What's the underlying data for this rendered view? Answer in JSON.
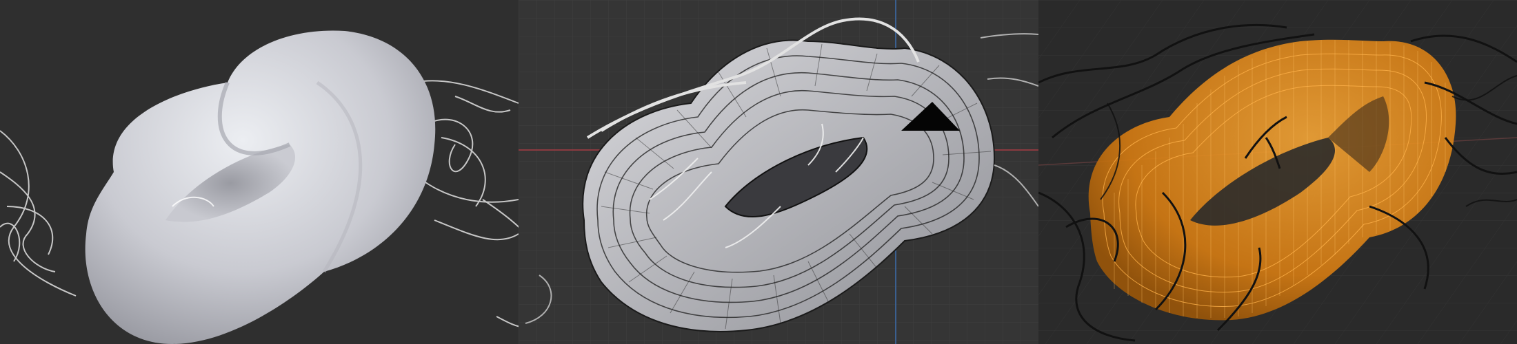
{
  "image": {
    "panels": [
      {
        "name": "solid-shaded-knot"
      },
      {
        "name": "wireframe-knot-edit-mode"
      },
      {
        "name": "xray-orange-wireframe-knot"
      }
    ],
    "colors": {
      "solid_bg": "#2f2f2f",
      "wire_bg": "#353535",
      "xray_bg": "#2a2a2a",
      "surface": "#cfd0d6",
      "curve_light": "#d8d8d8",
      "curve_dark": "#111111",
      "orange": "#e88a14",
      "grid": "#3e3e3e",
      "axis_red": "#8c3a40",
      "axis_blue": "#3a5f8f"
    }
  }
}
